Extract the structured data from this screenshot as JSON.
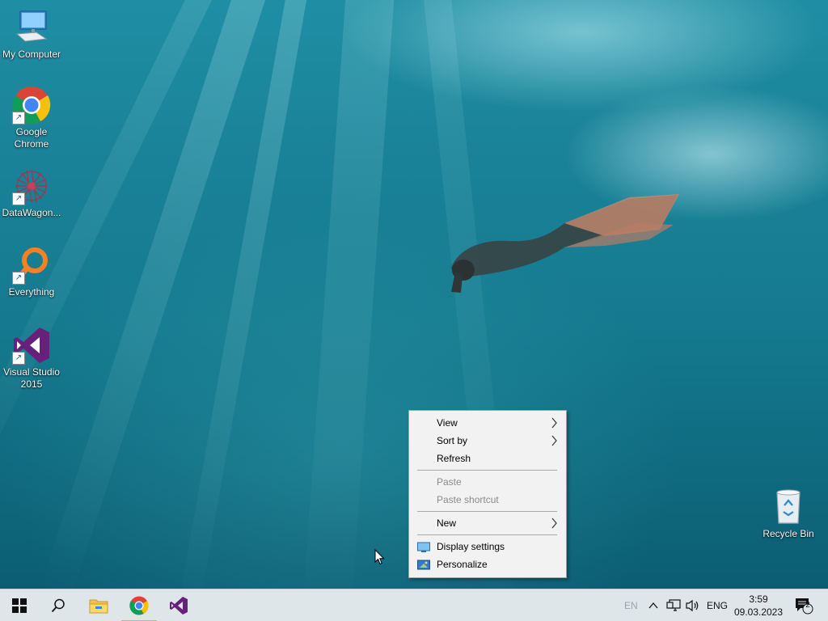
{
  "desktop_icons": [
    {
      "label": "My Computer",
      "icon": "computer-icon"
    },
    {
      "label": "Google Chrome",
      "icon": "chrome-icon"
    },
    {
      "label": "DataWagon...",
      "icon": "datawagon-icon"
    },
    {
      "label": "Everything",
      "icon": "everything-search-icon"
    },
    {
      "label": "Visual Studio 2015",
      "icon": "visual-studio-icon"
    },
    {
      "label": "Recycle Bin",
      "icon": "recycle-bin-icon"
    }
  ],
  "context_menu": {
    "view": "View",
    "sort_by": "Sort by",
    "refresh": "Refresh",
    "paste": "Paste",
    "paste_shortcut": "Paste shortcut",
    "new": "New",
    "display_settings": "Display settings",
    "personalize": "Personalize",
    "submenu_glyph": ">"
  },
  "taskbar": {
    "pinned": [
      "start-icon",
      "search-icon",
      "file-explorer-icon",
      "chrome-icon",
      "visual-studio-icon"
    ],
    "active_app": "chrome-icon",
    "active_indicator_color": "#e7b52f"
  },
  "tray": {
    "input_indicator": "EN",
    "language": "ENG",
    "time": "3:59",
    "date": "09.03.2023",
    "notification_count": "2"
  },
  "colors": {
    "menu_bg": "#f2f2f2",
    "taskbar_bg": "#dfe6ea",
    "vs_purple": "#68217a",
    "everything_orange": "#f58025"
  }
}
